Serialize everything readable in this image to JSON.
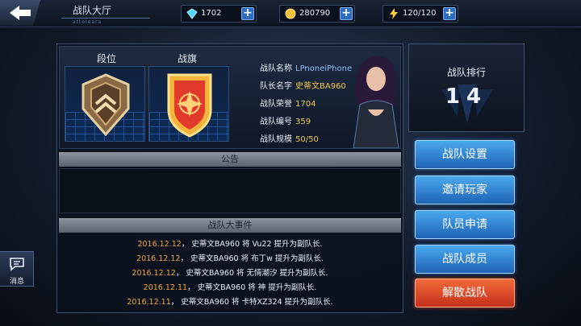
{
  "header": {
    "title": "战队大厅",
    "subtitle": "attoleara",
    "resources": [
      {
        "icon": "diamond-icon",
        "value": "1702"
      },
      {
        "icon": "gold-coin-icon",
        "value": "280790"
      },
      {
        "icon": "energy-bolt-icon",
        "value": "120/120"
      }
    ]
  },
  "team_info": {
    "rank_label": "段位",
    "flag_label": "战旗",
    "stats": [
      {
        "key": "战队名称",
        "value": "LPnoneiPhone"
      },
      {
        "key": "队长名字",
        "value": "史蒂文BA960"
      },
      {
        "key": "战队荣誉",
        "value": "1704"
      },
      {
        "key": "战队编号",
        "value": "359"
      },
      {
        "key": "战队规模",
        "value": "50/50"
      }
    ]
  },
  "notice": {
    "title": "公告",
    "body": ""
  },
  "events": {
    "title": "战队大事件",
    "items": [
      {
        "date": "2016.12.12",
        "text": "， 史蒂文BA960 将 Vu22 提升为副队长."
      },
      {
        "date": "2016.12.12",
        "text": "， 史蒂文BA960 将 布丁w 提升为副队长."
      },
      {
        "date": "2016.12.12",
        "text": "， 史蒂文BA960 将 无情潮汐 提升为副队长."
      },
      {
        "date": "2016.12.11",
        "text": "， 史蒂文BA960 将 神 提升为副队长."
      },
      {
        "date": "2016.12.11",
        "text": "， 史蒂文BA960 将 卡特XZ324 提升为副队长."
      }
    ]
  },
  "ranking": {
    "title": "战队排行",
    "value": "14"
  },
  "buttons": {
    "settings": "战队设置",
    "invite": "邀请玩家",
    "applications": "队员申请",
    "members": "战队成员",
    "disband": "解散战队"
  },
  "side": {
    "messages": "消息"
  },
  "colors": {
    "accent_blue": "#2f6bbf",
    "danger": "#d84020",
    "gold": "#f0c64a"
  }
}
